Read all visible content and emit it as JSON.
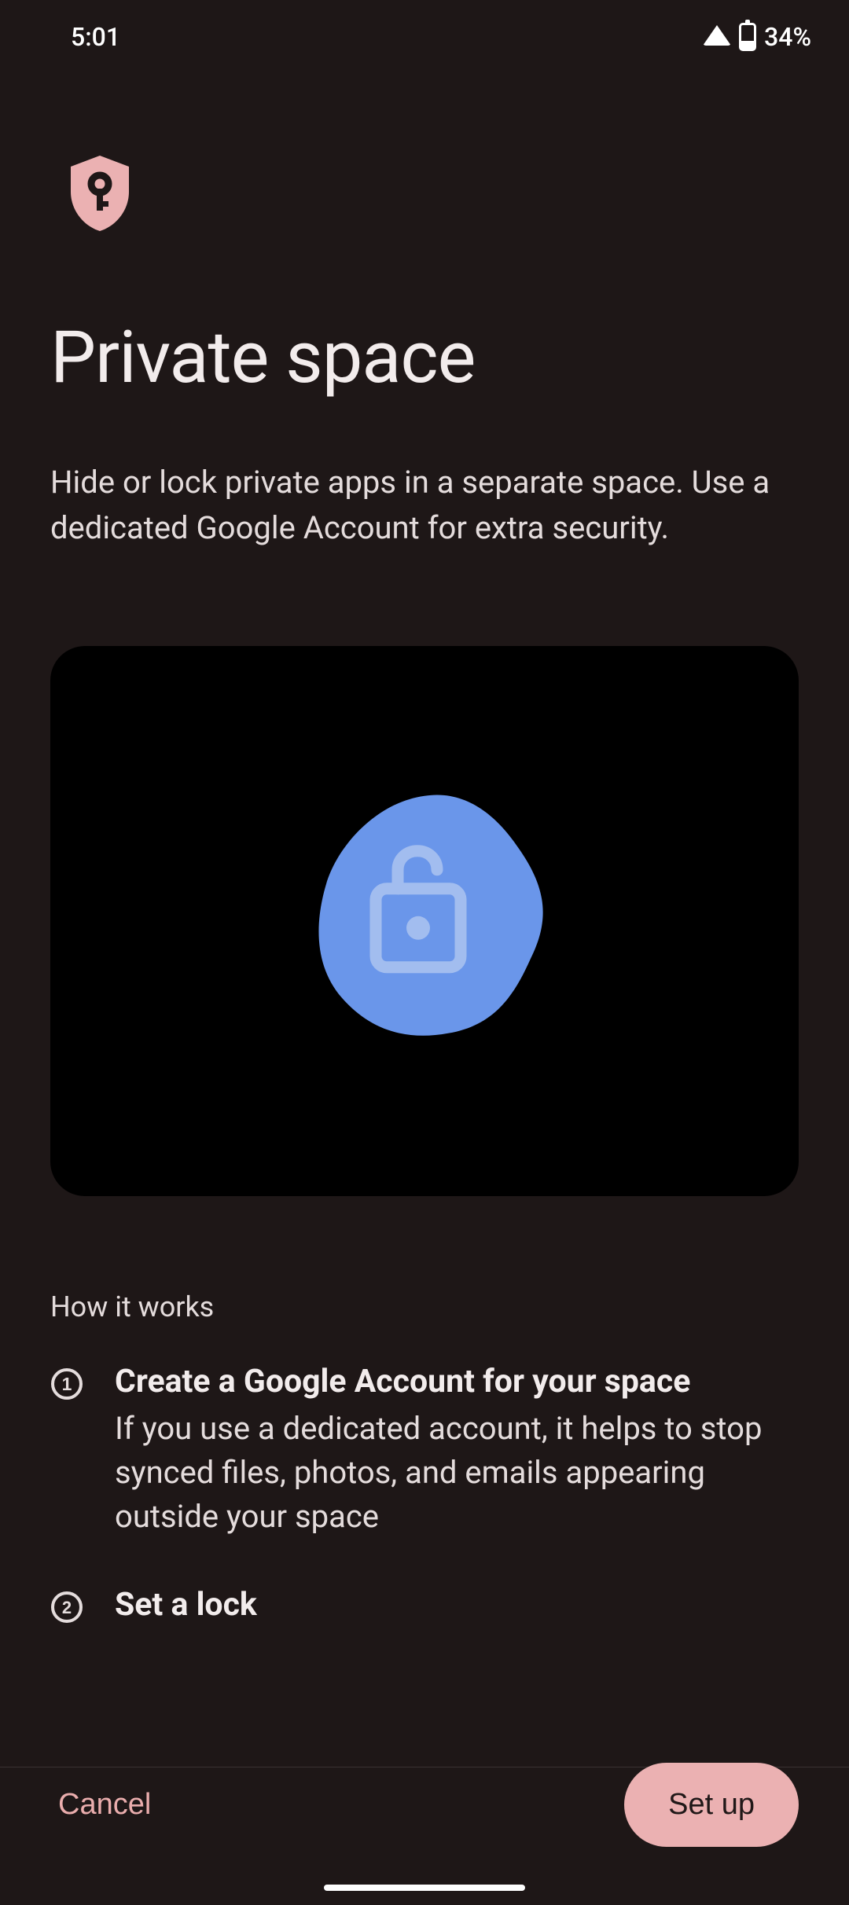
{
  "status_bar": {
    "time": "5:01",
    "battery_percent": "34%"
  },
  "header": {
    "title": "Private space",
    "description": "Hide or lock private apps in a separate space. Use a dedicated Google Account for extra security."
  },
  "how_it_works": {
    "section_title": "How it works",
    "steps": [
      {
        "title": "Create a Google Account for your space",
        "description": "If you use a dedicated account, it helps to stop synced files, photos, and emails appearing outside your space"
      },
      {
        "title": "Set a lock",
        "description": ""
      }
    ]
  },
  "bottom": {
    "cancel_label": "Cancel",
    "setup_label": "Set up"
  },
  "colors": {
    "accent": "#ebb1b2",
    "accent_text": "#eaadad",
    "blob": "#6a96ea",
    "lock_icon": "#a2bdef"
  }
}
